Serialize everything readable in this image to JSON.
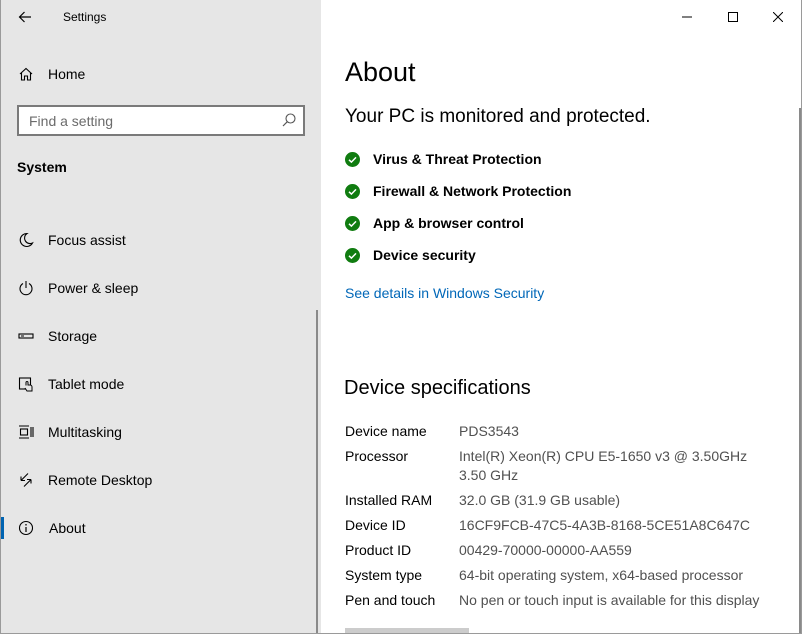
{
  "window": {
    "title": "Settings"
  },
  "sidebar": {
    "home_label": "Home",
    "search_placeholder": "Find a setting",
    "section": "System",
    "items": [
      {
        "label": "Focus assist",
        "icon": "moon-icon"
      },
      {
        "label": "Power & sleep",
        "icon": "power-icon"
      },
      {
        "label": "Storage",
        "icon": "storage-icon"
      },
      {
        "label": "Tablet mode",
        "icon": "tablet-icon"
      },
      {
        "label": "Multitasking",
        "icon": "multitasking-icon"
      },
      {
        "label": "Remote Desktop",
        "icon": "remote-desktop-icon"
      },
      {
        "label": "About",
        "icon": "info-icon",
        "selected": true
      }
    ]
  },
  "main": {
    "title": "About",
    "protection_status": "Your PC is monitored and protected.",
    "protections": [
      "Virus & Threat Protection",
      "Firewall & Network Protection",
      "App & browser control",
      "Device security"
    ],
    "security_link": "See details in Windows Security",
    "specs_title": "Device specifications",
    "specs": [
      {
        "key": "Device name",
        "value": "PDS3543"
      },
      {
        "key": "Processor",
        "value": "Intel(R) Xeon(R) CPU E5-1650 v3 @ 3.50GHz   3.50 GHz"
      },
      {
        "key": "Installed RAM",
        "value": "32.0 GB (31.9 GB usable)"
      },
      {
        "key": "Device ID",
        "value": "16CF9FCB-47C5-4A3B-8168-5CE51A8C647C"
      },
      {
        "key": "Product ID",
        "value": "00429-70000-00000-AA559"
      },
      {
        "key": "System type",
        "value": "64-bit operating system, x64-based processor"
      },
      {
        "key": "Pen and touch",
        "value": "No pen or touch input is available for this display"
      }
    ]
  },
  "colors": {
    "accent": "#0063b1",
    "link": "#0067b8",
    "check_green": "#107c10",
    "sidebar_bg": "#e6e6e6"
  }
}
